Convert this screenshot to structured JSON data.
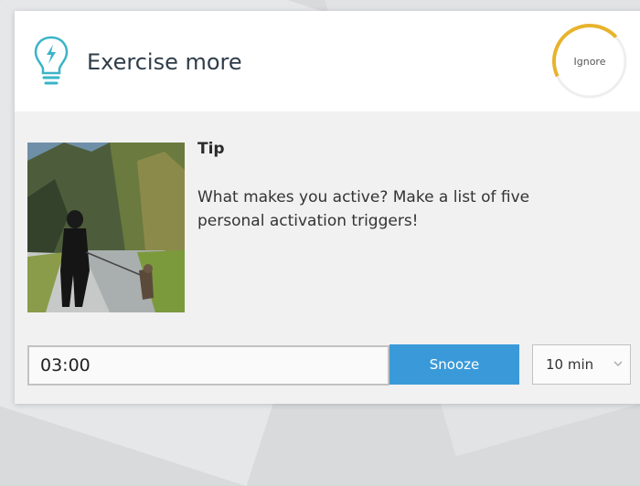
{
  "header": {
    "title": "Exercise more",
    "icon": "lightbulb-icon",
    "accent_color": "#3ab4c8"
  },
  "ignore": {
    "label": "Ignore",
    "ring_color": "#e8b32c",
    "progress_fraction": 0.45
  },
  "tip": {
    "label": "Tip",
    "body": "What makes you active? Make a list of five personal activation triggers!",
    "image": "photo-person-walking-dog"
  },
  "footer": {
    "time_value": "03:00",
    "snooze_label": "Snooze",
    "snooze_color": "#3a9ad9",
    "duration_value": "10 min"
  }
}
